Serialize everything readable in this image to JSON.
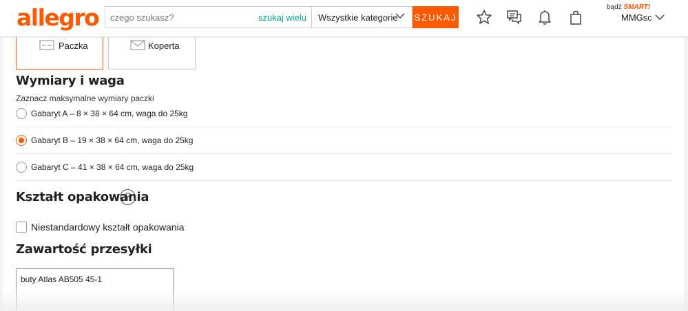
{
  "header": {
    "logo": "allegro",
    "search": {
      "placeholder": "czego szukasz?",
      "value": ""
    },
    "multi_search_label": "szukaj wielu",
    "category": "Wszystkie kategorie",
    "search_button": "SZUKAJ",
    "smart_prefix": "bądź",
    "smart_label": "SMART!",
    "user_name": "MMGsc",
    "icons": [
      "star-icon",
      "chat-icon",
      "bell-icon",
      "bag-icon"
    ]
  },
  "package_types": [
    {
      "label": "Paczka",
      "selected": true,
      "icon": "package-icon"
    },
    {
      "label": "Koperta",
      "selected": false,
      "icon": "envelope-icon"
    }
  ],
  "dimensions": {
    "title": "Wymiary i waga",
    "note": "Zaznacz maksymalne wymiary paczki",
    "options": [
      {
        "label": "Gabaryt A – 8 × 38 × 64 cm, waga do 25kg",
        "checked": false
      },
      {
        "label": "Gabaryt B – 19 × 38 × 64 cm, waga do 25kg",
        "checked": true
      },
      {
        "label": "Gabaryt C – 41 × 38 × 64 cm, waga do 25kg",
        "checked": false
      }
    ]
  },
  "shape": {
    "title": "Kształt opakowania",
    "help_icon": "?",
    "checkbox_label": "Niestandardowy kształt opakowania",
    "checked": false
  },
  "contents": {
    "title": "Zawartość przesyłki",
    "value": "buty Atlas AB505 45-1"
  },
  "colors": {
    "accent": "#ff5a00",
    "link": "#00a790"
  }
}
